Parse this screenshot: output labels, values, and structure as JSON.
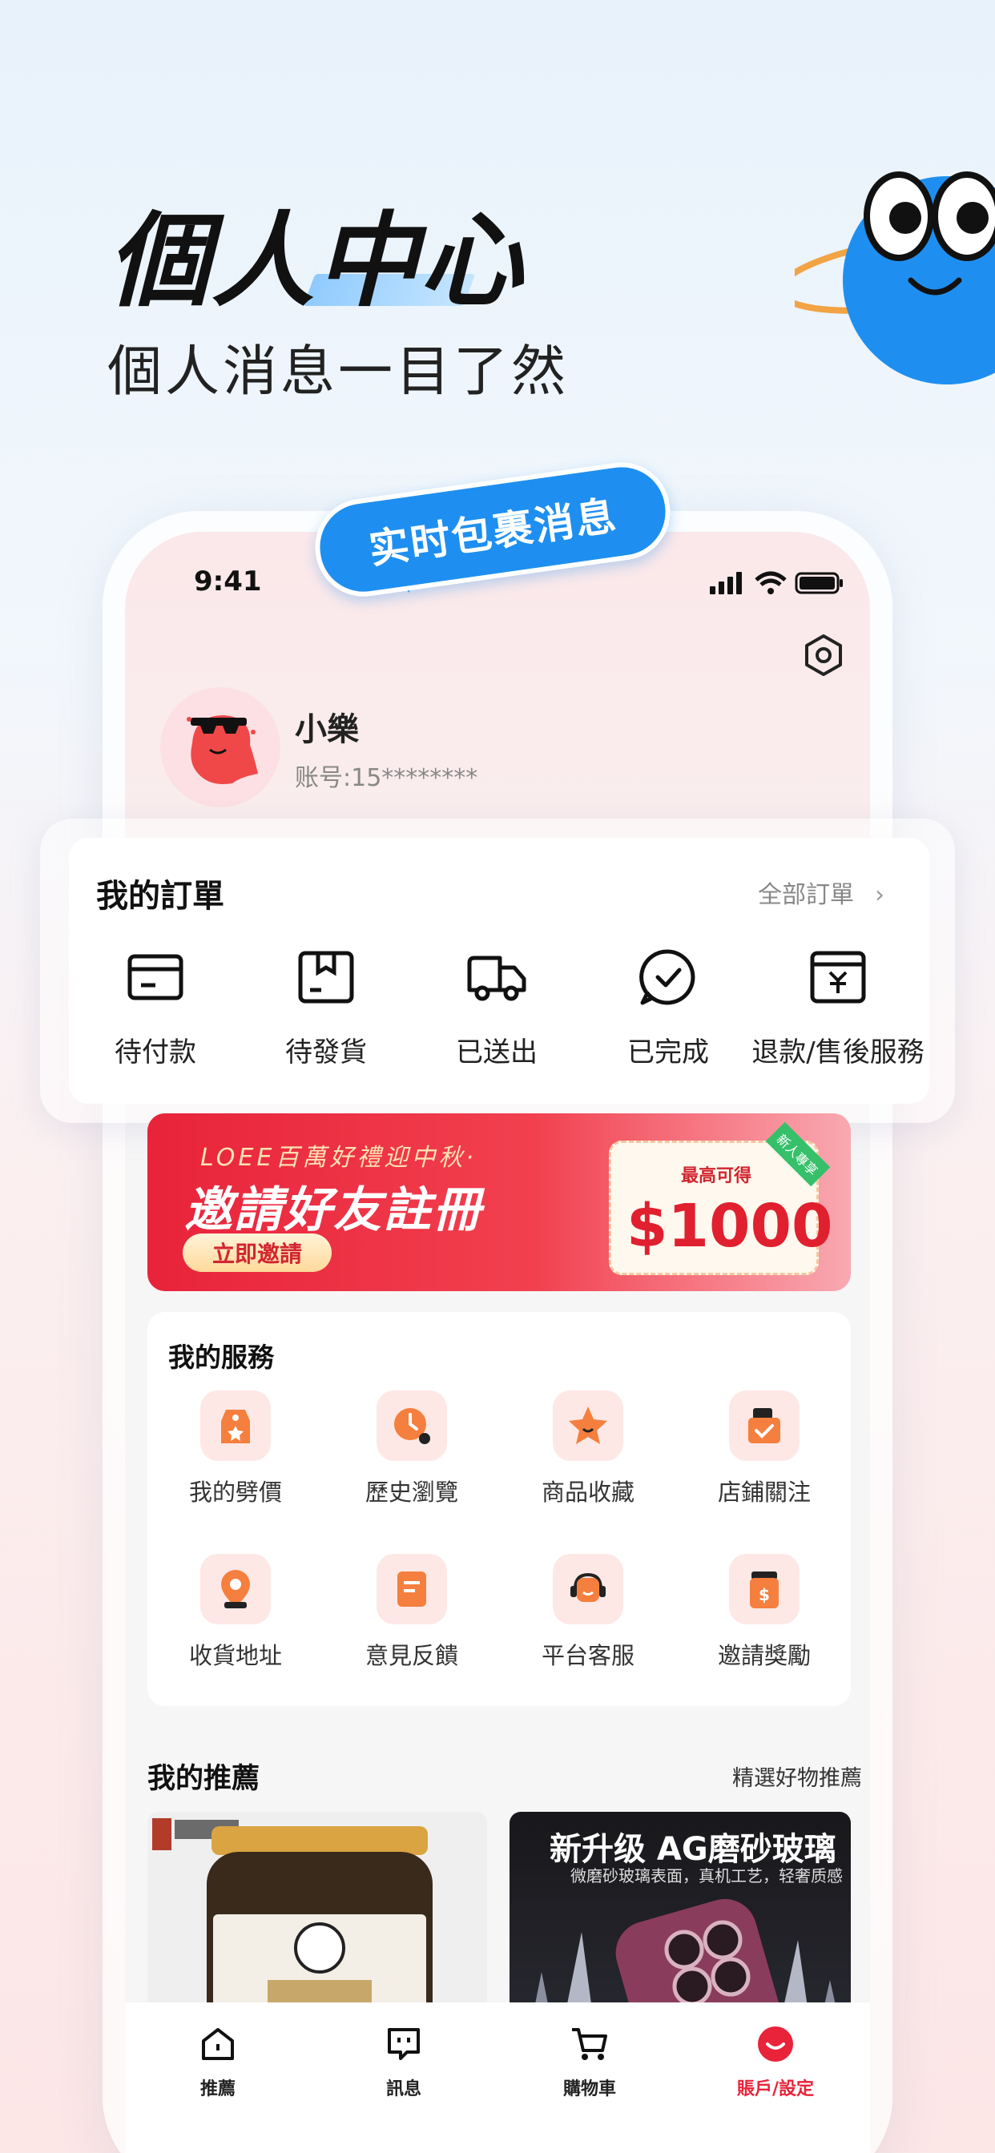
{
  "hero": {
    "title": "個人中心",
    "subtitle": "個人消息一目了然"
  },
  "callout": "实时包裹消息",
  "status_bar": {
    "time": "9:41"
  },
  "profile": {
    "name": "小樂",
    "account": "账号:15********"
  },
  "orders": {
    "title": "我的訂單",
    "all_label": "全部訂單",
    "items": [
      {
        "label": "待付款",
        "icon": "card-icon"
      },
      {
        "label": "待發貨",
        "icon": "box-icon"
      },
      {
        "label": "已送出",
        "icon": "truck-icon"
      },
      {
        "label": "已完成",
        "icon": "check-circle-icon"
      },
      {
        "label": "退款/售後服務",
        "icon": "refund-icon"
      }
    ]
  },
  "banner": {
    "top_text": "LOEE百萬好禮迎中秋·",
    "main_text": "邀請好友註冊",
    "button": "立即邀請",
    "coupon_top": "最高可得",
    "coupon_amount": "$1000",
    "ribbon": "新人專享"
  },
  "services": {
    "title": "我的服務",
    "items": [
      {
        "label": "我的劈價",
        "icon": "tag-icon"
      },
      {
        "label": "歷史瀏覽",
        "icon": "clock-icon"
      },
      {
        "label": "商品收藏",
        "icon": "star-icon"
      },
      {
        "label": "店鋪關注",
        "icon": "store-check-icon"
      },
      {
        "label": "收貨地址",
        "icon": "location-icon"
      },
      {
        "label": "意見反饋",
        "icon": "feedback-icon"
      },
      {
        "label": "平台客服",
        "icon": "headset-icon"
      },
      {
        "label": "邀請獎勵",
        "icon": "reward-icon"
      }
    ]
  },
  "recommend": {
    "title": "我的推薦",
    "more": "精選好物推薦",
    "products": [
      {
        "image": "jar-product-image"
      },
      {
        "title": "新升级 AG磨砂玻璃",
        "subtitle": "微磨砂玻璃表面，真机工艺，轻奢质感"
      }
    ]
  },
  "tabbar": {
    "items": [
      {
        "label": "推薦",
        "icon": "home-icon"
      },
      {
        "label": "訊息",
        "icon": "message-icon"
      },
      {
        "label": "購物車",
        "icon": "cart-icon"
      },
      {
        "label": "賬戶/設定",
        "icon": "account-icon",
        "active": true
      }
    ]
  },
  "colors": {
    "accent_red": "#e8233a",
    "accent_blue": "#1e8ff0"
  }
}
